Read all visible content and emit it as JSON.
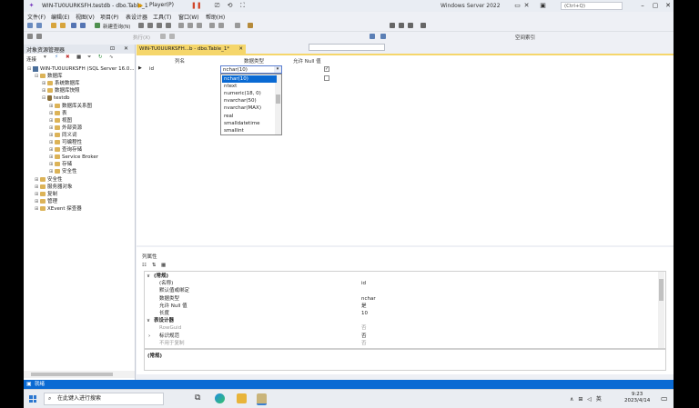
{
  "window": {
    "title": "WIN-TU0UURKSFH.testdb - dbo.Table_1",
    "player_label": "Player(P)",
    "os_label": "Windows Server 2022",
    "quick_search_placeholder": "(Ctrl+Q)"
  },
  "menu": [
    "文件(F)",
    "编辑(E)",
    "视图(V)",
    "项目(P)",
    "表设计器",
    "工具(T)",
    "窗口(W)",
    "帮助(H)"
  ],
  "toolbar": {
    "new_query_label": "新建查询(N)",
    "execute_label": "执行(X)",
    "space_label": "空间索引"
  },
  "object_explorer": {
    "title": "对象资源管理器",
    "connect_label": "连接",
    "nodes": [
      {
        "label": "WIN-TU0UURKSFH (SQL Server 16.0...",
        "depth": 0,
        "expander": "⊟",
        "icon": "server"
      },
      {
        "label": "数据库",
        "depth": 1,
        "expander": "⊟",
        "icon": "folder"
      },
      {
        "label": "系统数据库",
        "depth": 2,
        "expander": "⊞",
        "icon": "folder"
      },
      {
        "label": "数据库快照",
        "depth": 2,
        "expander": "⊞",
        "icon": "folder"
      },
      {
        "label": "testdb",
        "depth": 2,
        "expander": "⊟",
        "icon": "database"
      },
      {
        "label": "数据库关系图",
        "depth": 3,
        "expander": "⊞",
        "icon": "folder"
      },
      {
        "label": "表",
        "depth": 3,
        "expander": "⊞",
        "icon": "folder"
      },
      {
        "label": "视图",
        "depth": 3,
        "expander": "⊞",
        "icon": "folder"
      },
      {
        "label": "外部资源",
        "depth": 3,
        "expander": "⊞",
        "icon": "folder"
      },
      {
        "label": "同义词",
        "depth": 3,
        "expander": "⊞",
        "icon": "folder"
      },
      {
        "label": "可编程性",
        "depth": 3,
        "expander": "⊞",
        "icon": "folder"
      },
      {
        "label": "查询存储",
        "depth": 3,
        "expander": "⊞",
        "icon": "folder"
      },
      {
        "label": "Service Broker",
        "depth": 3,
        "expander": "⊞",
        "icon": "folder"
      },
      {
        "label": "存储",
        "depth": 3,
        "expander": "⊞",
        "icon": "folder"
      },
      {
        "label": "安全性",
        "depth": 3,
        "expander": "⊞",
        "icon": "folder"
      },
      {
        "label": "安全性",
        "depth": 1,
        "expander": "⊞",
        "icon": "folder"
      },
      {
        "label": "服务器对象",
        "depth": 1,
        "expander": "⊞",
        "icon": "folder"
      },
      {
        "label": "复制",
        "depth": 1,
        "expander": "⊞",
        "icon": "folder"
      },
      {
        "label": "管理",
        "depth": 1,
        "expander": "⊞",
        "icon": "folder"
      },
      {
        "label": "XEvent 探查器",
        "depth": 1,
        "expander": "⊞",
        "icon": "folder"
      }
    ]
  },
  "designer": {
    "tab_label": "WIN-TU0UURKSFH...b - dbo.Table_1*",
    "headers": {
      "column_name": "列名",
      "data_type": "数据类型",
      "allow_null": "允许 Null 值"
    },
    "row": {
      "column_name": "id",
      "data_type": "nchar(10)",
      "allow_null_checked": true
    },
    "type_options": [
      "nchar(10)",
      "ntext",
      "numeric(18, 0)",
      "nvarchar(50)",
      "nvarchar(MAX)",
      "real",
      "smalldatetime",
      "smallint"
    ],
    "selected_option_index": 0
  },
  "properties": {
    "tab_label": "列属性",
    "rows": [
      {
        "type": "cat",
        "expander": "∨",
        "name": "(常规)"
      },
      {
        "type": "prop",
        "name": "(名称)",
        "value": "id"
      },
      {
        "type": "prop",
        "name": "默认值或绑定",
        "value": ""
      },
      {
        "type": "prop",
        "name": "数据类型",
        "value": "nchar"
      },
      {
        "type": "prop",
        "name": "允许 Null 值",
        "value": "是"
      },
      {
        "type": "prop",
        "name": "长度",
        "value": "10"
      },
      {
        "type": "cat",
        "expander": "∨",
        "name": "表设计器"
      },
      {
        "type": "prop",
        "name": "RowGuid",
        "value": "否",
        "dim": true
      },
      {
        "type": "prop",
        "name": "标识规范",
        "value": "否",
        "expander": "›"
      },
      {
        "type": "prop",
        "name": "不用于复制",
        "value": "否",
        "dim": true
      }
    ],
    "description_title": "(常规)"
  },
  "status": {
    "text": "就绪"
  },
  "taskbar": {
    "search_placeholder": "在此键入进行搜索",
    "ime_label": "英",
    "time": "9:23",
    "date": "2023/4/14"
  },
  "colors": {
    "accent": "#0a6ad3",
    "tab_active": "#f5d66b"
  }
}
